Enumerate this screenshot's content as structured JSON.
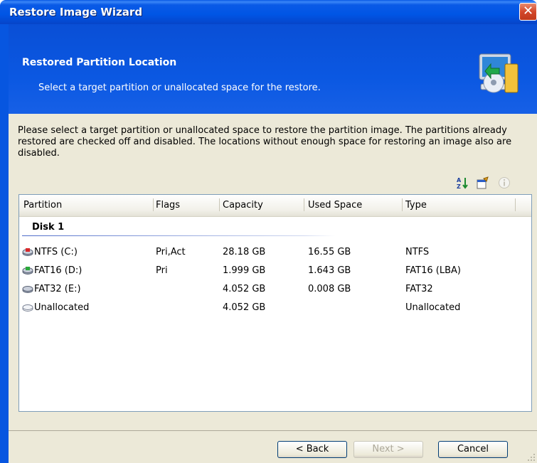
{
  "window": {
    "title": "Restore Image Wizard",
    "close_label": "✕"
  },
  "header": {
    "title": "Restored Partition Location",
    "subtitle": "Select a target partition or unallocated space for the restore."
  },
  "description": "Please select a target partition or unallocated space to restore the partition image. The partitions already restored are checked off and disabled. The locations without enough space for restoring an image also are disabled.",
  "toolbar": {
    "icons": [
      "sort-icon",
      "properties-icon",
      "info-icon"
    ]
  },
  "list": {
    "columns": [
      "Partition",
      "Flags",
      "Capacity",
      "Used Space",
      "Type"
    ],
    "group": "Disk 1",
    "rows": [
      {
        "partition": "NTFS (C:)",
        "flags": "Pri,Act",
        "capacity": "28.18 GB",
        "used": "16.55 GB",
        "type": "NTFS",
        "icon": "red-disk-icon"
      },
      {
        "partition": "FAT16 (D:)",
        "flags": "Pri",
        "capacity": "1.999 GB",
        "used": "1.643 GB",
        "type": "FAT16 (LBA)",
        "icon": "green-disk-icon"
      },
      {
        "partition": "FAT32 (E:)",
        "flags": "",
        "capacity": "4.052 GB",
        "used": "0.008 GB",
        "type": "FAT32",
        "icon": "gray-disk-icon"
      },
      {
        "partition": "Unallocated",
        "flags": "",
        "capacity": "4.052 GB",
        "used": "",
        "type": "Unallocated",
        "icon": "unallocated-disk-icon"
      }
    ]
  },
  "buttons": {
    "back": "< Back",
    "next": "Next >",
    "cancel": "Cancel"
  },
  "colors": {
    "banner": "#0b58e2",
    "body": "#ece9d8",
    "close": "#d3472a"
  }
}
